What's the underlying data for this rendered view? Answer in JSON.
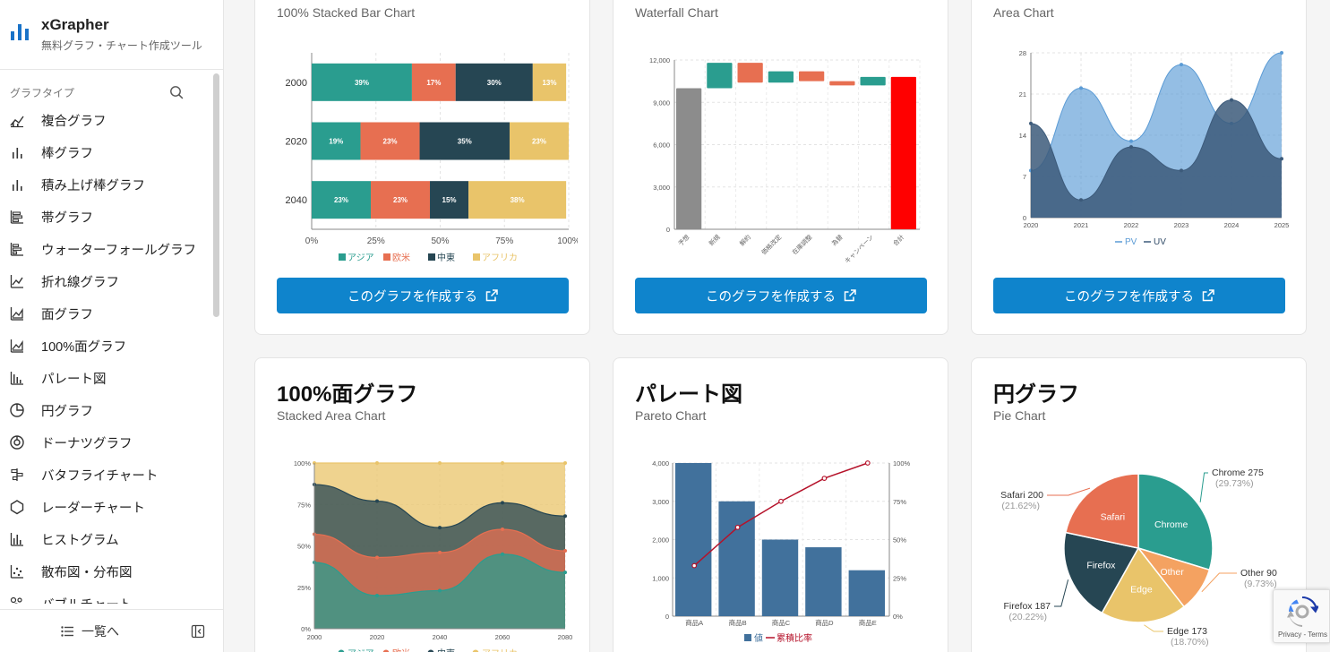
{
  "sidebar": {
    "brand_title": "xGrapher",
    "brand_subtitle": "無料グラフ・チャート作成ツール",
    "section_label": "グラフタイプ",
    "items": [
      {
        "label": "複合グラフ",
        "icon": "combo-chart-icon"
      },
      {
        "label": "棒グラフ",
        "icon": "bar-chart-icon"
      },
      {
        "label": "積み上げ棒グラフ",
        "icon": "stacked-bar-icon"
      },
      {
        "label": "帯グラフ",
        "icon": "band-chart-icon"
      },
      {
        "label": "ウォーターフォールグラフ",
        "icon": "waterfall-icon"
      },
      {
        "label": "折れ線グラフ",
        "icon": "line-chart-icon"
      },
      {
        "label": "面グラフ",
        "icon": "area-chart-icon"
      },
      {
        "label": "100%面グラフ",
        "icon": "stacked-area-icon"
      },
      {
        "label": "パレート図",
        "icon": "pareto-icon"
      },
      {
        "label": "円グラフ",
        "icon": "pie-chart-icon"
      },
      {
        "label": "ドーナツグラフ",
        "icon": "donut-chart-icon"
      },
      {
        "label": "バタフライチャート",
        "icon": "butterfly-icon"
      },
      {
        "label": "レーダーチャート",
        "icon": "radar-icon"
      },
      {
        "label": "ヒストグラム",
        "icon": "histogram-icon"
      },
      {
        "label": "散布図・分布図",
        "icon": "scatter-icon"
      },
      {
        "label": "バブルチャート",
        "icon": "bubble-icon"
      }
    ],
    "list_label": "一覧へ"
  },
  "button_label": "このグラフを作成する",
  "cards": [
    {
      "subtitle": "100% Stacked Bar Chart"
    },
    {
      "subtitle": "Waterfall Chart"
    },
    {
      "subtitle": "Area Chart"
    },
    {
      "title": "100%面グラフ",
      "subtitle": "Stacked Area Chart"
    },
    {
      "title": "パレート図",
      "subtitle": "Pareto Chart"
    },
    {
      "title": "円グラフ",
      "subtitle": "Pie Chart"
    }
  ],
  "recaptcha": {
    "text": "Privacy - Terms"
  },
  "chart_data": [
    {
      "type": "bar",
      "orientation": "horizontal-stacked-100",
      "categories": [
        "2000",
        "2020",
        "2040"
      ],
      "series": [
        {
          "name": "アジア",
          "values": [
            39,
            19,
            23
          ],
          "color": "#2a9d8f"
        },
        {
          "name": "欧米",
          "values": [
            17,
            23,
            23
          ],
          "color": "#e76f51"
        },
        {
          "name": "中東",
          "values": [
            30,
            35,
            15
          ],
          "color": "#264653"
        },
        {
          "name": "アフリカ",
          "values": [
            13,
            23,
            38
          ],
          "color": "#e9c46a"
        }
      ],
      "xticks": [
        "0%",
        "25%",
        "50%",
        "75%",
        "100%"
      ],
      "xlim": [
        0,
        100
      ]
    },
    {
      "type": "bar",
      "variant": "waterfall",
      "categories": [
        "予想",
        "新規",
        "解約",
        "価格改定",
        "在庫調整",
        "為替",
        "キャンペーン",
        "合計"
      ],
      "bars": [
        {
          "start": 0,
          "end": 10000,
          "color": "#8c8c8c"
        },
        {
          "start": 10000,
          "end": 11800,
          "color": "#2a9d8f"
        },
        {
          "start": 11800,
          "end": 10400,
          "color": "#e76f51"
        },
        {
          "start": 10400,
          "end": 11200,
          "color": "#2a9d8f"
        },
        {
          "start": 11200,
          "end": 10500,
          "color": "#e76f51"
        },
        {
          "start": 10500,
          "end": 10200,
          "color": "#e76f51"
        },
        {
          "start": 10200,
          "end": 10800,
          "color": "#2a9d8f"
        },
        {
          "start": 0,
          "end": 10800,
          "color": "#ff0000"
        }
      ],
      "yticks": [
        "0",
        "3,000",
        "6,000",
        "9,000",
        "12,000"
      ],
      "ylim": [
        0,
        12000
      ]
    },
    {
      "type": "area",
      "x": [
        "2020",
        "2021",
        "2022",
        "2023",
        "2024",
        "2025"
      ],
      "series": [
        {
          "name": "PV",
          "values": [
            8,
            22,
            13,
            26,
            16,
            28
          ],
          "color": "#5b9bd5"
        },
        {
          "name": "UV",
          "values": [
            16,
            3,
            12,
            8,
            20,
            10
          ],
          "color": "#3c5a7a"
        }
      ],
      "yticks": [
        "0",
        "7",
        "14",
        "21",
        "28"
      ],
      "ylim": [
        0,
        28
      ]
    },
    {
      "type": "area",
      "variant": "stacked-100",
      "x": [
        "2000",
        "2020",
        "2040",
        "2060",
        "2080"
      ],
      "series": [
        {
          "name": "アジア",
          "values": [
            40,
            20,
            23,
            45,
            34
          ],
          "color": "#2a9d8f"
        },
        {
          "name": "欧米",
          "values": [
            17,
            23,
            23,
            15,
            13
          ],
          "color": "#e76f51"
        },
        {
          "name": "中東",
          "values": [
            30,
            34,
            15,
            16,
            21
          ],
          "color": "#264653"
        },
        {
          "name": "アフリカ",
          "values": [
            13,
            23,
            39,
            24,
            32
          ],
          "color": "#e9c46a"
        }
      ],
      "yticks": [
        "0%",
        "25%",
        "50%",
        "75%",
        "100%"
      ],
      "ylim": [
        0,
        100
      ]
    },
    {
      "type": "bar",
      "variant": "pareto",
      "categories": [
        "商品A",
        "商品B",
        "商品C",
        "商品D",
        "商品E"
      ],
      "values": [
        4000,
        3000,
        2000,
        1800,
        1200
      ],
      "cumulative_percent": [
        33,
        58,
        75,
        90,
        100
      ],
      "series_names": [
        "値",
        "累積比率"
      ],
      "yticks": [
        "0",
        "1,000",
        "2,000",
        "3,000",
        "4,000"
      ],
      "y2ticks": [
        "0%",
        "25%",
        "50%",
        "75%",
        "100%"
      ],
      "ylim": [
        0,
        4000
      ],
      "colors": {
        "bar": "#41719c",
        "line": "#b5122a"
      }
    },
    {
      "type": "pie",
      "slices": [
        {
          "label": "Chrome",
          "value": 275,
          "percent": "(29.73%)",
          "color": "#2a9d8f"
        },
        {
          "label": "Other",
          "value": 90,
          "percent": "(9.73%)",
          "color": "#f4a261"
        },
        {
          "label": "Edge",
          "value": 173,
          "percent": "(18.70%)",
          "color": "#e9c46a"
        },
        {
          "label": "Firefox",
          "value": 187,
          "percent": "(20.22%)",
          "color": "#264653"
        },
        {
          "label": "Safari",
          "value": 200,
          "percent": "(21.62%)",
          "color": "#e76f51"
        }
      ]
    }
  ]
}
